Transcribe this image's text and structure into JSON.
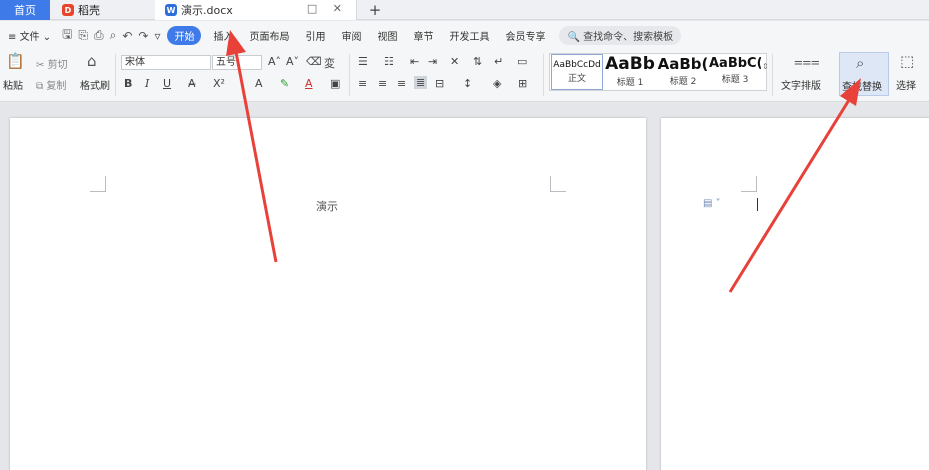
{
  "tabs": {
    "home": "首页",
    "daoke": "稻壳",
    "document": "演示.docx",
    "new_tab": "+",
    "doc_actions": "□ ✕"
  },
  "menu": {
    "file": "文件",
    "items": [
      "开始",
      "插入",
      "页面布局",
      "引用",
      "审阅",
      "视图",
      "章节",
      "开发工具",
      "会员专享"
    ],
    "search_placeholder": "查找命令、搜索模板"
  },
  "ribbon": {
    "paste": "粘贴",
    "cut": "剪切",
    "copy": "复制",
    "format_painter": "格式刷",
    "font_name": "宋体",
    "font_size": "五号",
    "bold": "B",
    "italic": "I",
    "underline": "U",
    "styles": [
      {
        "sample": "AaBbCcDd",
        "name": "正文"
      },
      {
        "sample": "AaBb",
        "name": "标题 1"
      },
      {
        "sample": "AaBb(",
        "name": "标题 2"
      },
      {
        "sample": "AaBbC(",
        "name": "标题 3"
      }
    ],
    "text_layout": "文字排版",
    "find_replace": "查找替换",
    "select": "选择"
  },
  "document": {
    "text": "演示"
  },
  "colors": {
    "accent": "#3f7be8",
    "arrow": "#e8413a"
  }
}
